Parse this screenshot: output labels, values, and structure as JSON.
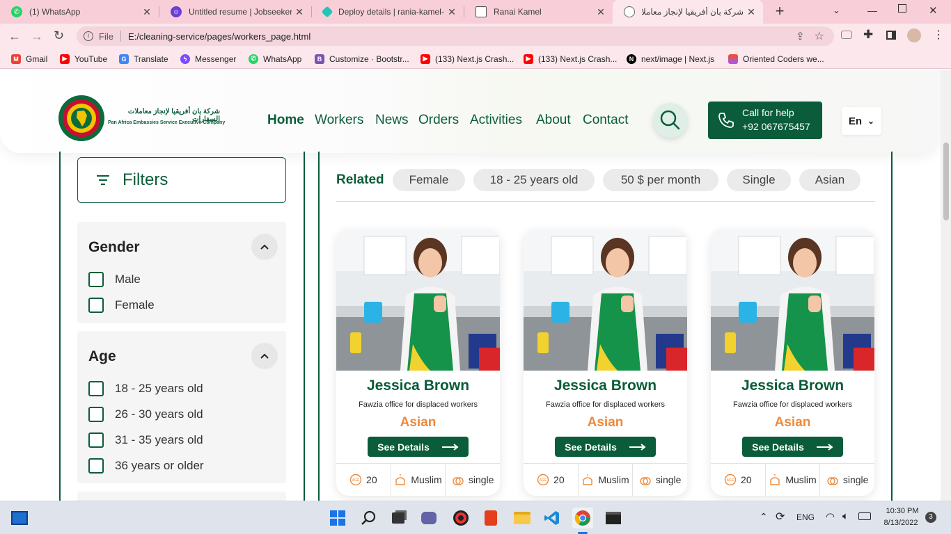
{
  "browser": {
    "tabs": [
      {
        "title": "(1) WhatsApp",
        "icon": "whatsapp-icon",
        "color": "#25d366"
      },
      {
        "title": "Untitled resume | Jobseeker",
        "icon": "jobseeker-icon",
        "color": "#6b3fd4"
      },
      {
        "title": "Deploy details | rania-kamel-",
        "icon": "netlify-icon",
        "color": "#20c6b7"
      },
      {
        "title": "Ranai Kamel",
        "icon": "page-icon",
        "color": "#555555"
      },
      {
        "title": "شركة بان أفريقيا لإنجاز معاملات",
        "icon": "globe-icon",
        "color": "#555555"
      }
    ],
    "new_tab": "+",
    "url_scheme": "File",
    "url": "E:/cleaning-service/pages/workers_page.html",
    "bookmarks": [
      {
        "label": "Gmail",
        "icon": "gmail-icon",
        "color": "#ea4335"
      },
      {
        "label": "YouTube",
        "icon": "youtube-icon",
        "color": "#ff0000"
      },
      {
        "label": "Translate",
        "icon": "translate-icon",
        "color": "#4285f4"
      },
      {
        "label": "Messenger",
        "icon": "messenger-icon",
        "color": "#7b4cff"
      },
      {
        "label": "WhatsApp",
        "icon": "whatsapp-icon",
        "color": "#25d366"
      },
      {
        "label": "Customize · Bootstr...",
        "icon": "bootstrap-icon",
        "color": "#7952b3"
      },
      {
        "label": "(133) Next.js Crash...",
        "icon": "youtube-icon",
        "color": "#ff0000"
      },
      {
        "label": "(133) Next.js Crash...",
        "icon": "youtube-icon",
        "color": "#ff0000"
      },
      {
        "label": "next/image | Next.js",
        "icon": "nextjs-icon",
        "color": "#000000"
      },
      {
        "label": "Oriented Coders we...",
        "icon": "figma-icon",
        "color": "#f24e1e"
      }
    ]
  },
  "site": {
    "logo_text_ar": "شركة بان أفريقيا لإنجاز معاملات السفارات",
    "logo_text_en": "Pan Africa Embassies Service Executive Company",
    "nav": [
      "Home",
      "Workers",
      "News",
      "Orders",
      "Activities",
      "About",
      "Contact"
    ],
    "call_label": "Call for help",
    "call_number": "+92 067675457",
    "lang": "En",
    "brand_color": "#0a5c3a",
    "accent_color": "#ee8a3c"
  },
  "filters": {
    "title": "Filters",
    "groups": [
      {
        "title": "Gender",
        "options": [
          "Male",
          "Female"
        ]
      },
      {
        "title": "Age",
        "options": [
          "18 - 25 years old",
          "26 - 30 years old",
          "31 - 35 years old",
          "36 years or older"
        ]
      }
    ]
  },
  "related": {
    "label": "Related",
    "chips": [
      "Female",
      "18 - 25 years old",
      "50 $ per month",
      "Single",
      "Asian"
    ]
  },
  "workers": [
    {
      "name": "Jessica Brown",
      "office": "Fawzia office for displaced workers",
      "origin": "Asian",
      "button": "See Details",
      "age": "20",
      "religion": "Muslim",
      "status": "single"
    },
    {
      "name": "Jessica Brown",
      "office": "Fawzia office for displaced workers",
      "origin": "Asian",
      "button": "See Details",
      "age": "20",
      "religion": "Muslim",
      "status": "single"
    },
    {
      "name": "Jessica Brown",
      "office": "Fawzia office for displaced workers",
      "origin": "Asian",
      "button": "See Details",
      "age": "20",
      "religion": "Muslim",
      "status": "single"
    }
  ],
  "taskbar": {
    "lang": "ENG",
    "time": "10:30 PM",
    "date": "8/13/2022",
    "notifications": "3"
  }
}
